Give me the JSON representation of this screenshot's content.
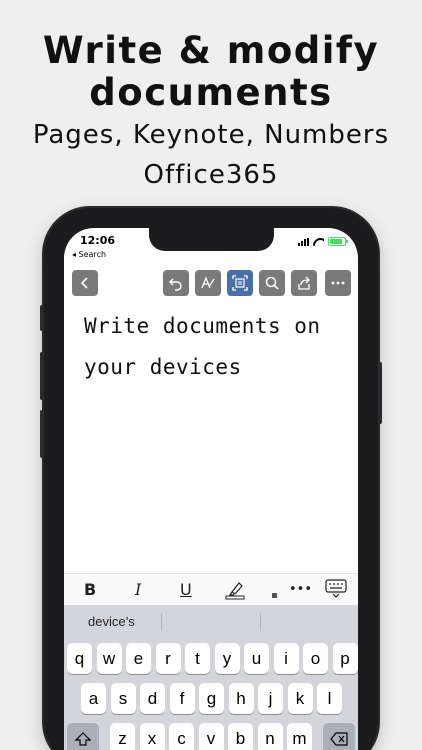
{
  "headline": {
    "line1": "Write & modify",
    "line2": "documents",
    "line3": "Pages, Keynote, Numbers",
    "line4": "Office365"
  },
  "status_bar": {
    "time": "12:06",
    "back_label": "◂ Search"
  },
  "toolbar": {
    "icons": [
      "back-icon",
      "undo-icon",
      "handwriting-icon",
      "select-frame-icon",
      "search-icon",
      "share-icon",
      "more-icon"
    ]
  },
  "document": {
    "line1": "Write documents on",
    "line2": "your devices"
  },
  "format_bar": {
    "bold": "B",
    "italic": "I",
    "underline": "U",
    "more": "•••"
  },
  "keyboard": {
    "suggestion": "device’s",
    "row1": [
      "q",
      "w",
      "e",
      "r",
      "t",
      "y",
      "u",
      "i",
      "o",
      "p"
    ],
    "row2": [
      "a",
      "s",
      "d",
      "f",
      "g",
      "h",
      "j",
      "k",
      "l"
    ],
    "row3": [
      "z",
      "x",
      "c",
      "v",
      "b",
      "n",
      "m"
    ]
  },
  "colors": {
    "background": "#f0efef",
    "toolbar_button": "#7a7a7a",
    "toolbar_active": "#4a6fa5",
    "keyboard_bg": "#d3d5da"
  }
}
